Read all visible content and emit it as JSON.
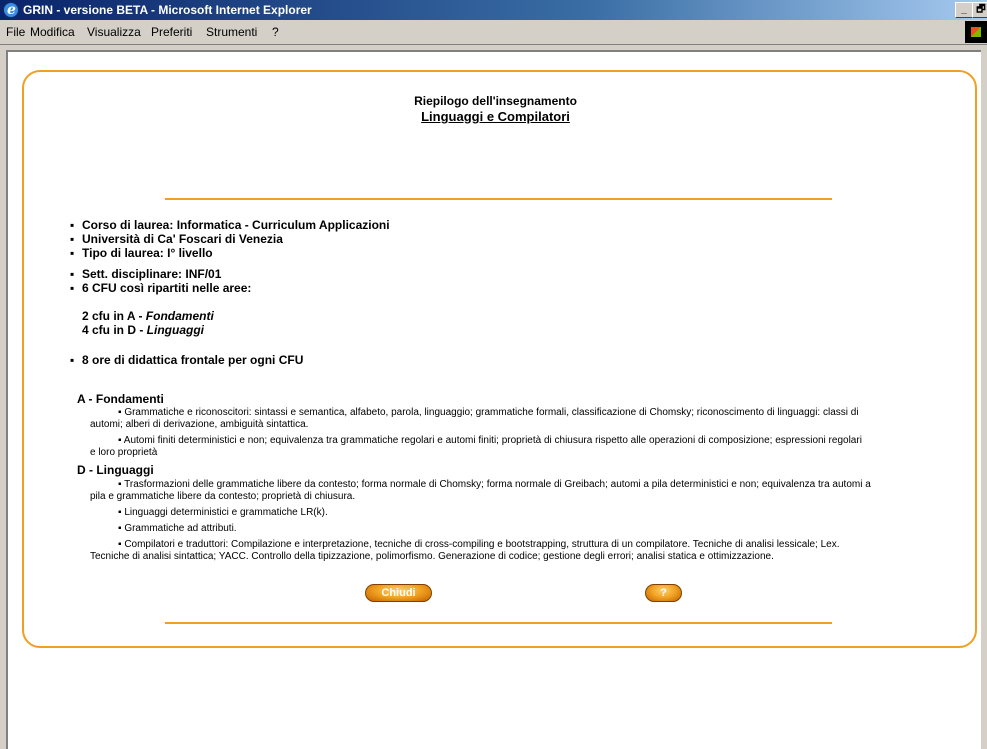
{
  "window": {
    "title": "GRIN - versione BETA - Microsoft Internet Explorer",
    "minimize": "_",
    "maximize": "🗗"
  },
  "menu": [
    "File",
    "Modifica",
    "Visualizza",
    "Preferiti",
    "Strumenti",
    "?"
  ],
  "page": {
    "heading": "Riepilogo dell'insegnamento",
    "course_title": "Linguaggi e Compilatori",
    "info": [
      "Corso di laurea: Informatica - Curriculum Applicazioni",
      "Università di Ca' Foscari di Venezia",
      "Tipo di laurea: I° livello",
      "Sett. disciplinare: INF/01",
      "6 CFU  così ripartiti nelle aree:"
    ],
    "cfu_areas": [
      {
        "prefix": "2 cfu in A - ",
        "area": "Fondamenti"
      },
      {
        "prefix": "4 cfu in D - ",
        "area": "Linguaggi"
      }
    ],
    "hours": "8 ore di didattica frontale per ogni CFU",
    "sections": [
      {
        "title": "A - Fondamenti",
        "topics": [
          {
            "line1": "Grammatiche e riconoscitori: sintassi e semantica, alfabeto, parola, linguaggio; grammatiche formali, classificazione di Chomsky; riconoscimento di linguaggi: classi di",
            "line2": "automi; alberi di derivazione, ambiguità sintattica."
          },
          {
            "line1": "Automi finiti deterministici e non; equivalenza tra grammatiche regolari e automi finiti; proprietà di chiusura rispetto alle operazioni di composizione; espressioni regolari",
            "line2": "e loro proprietà"
          }
        ]
      },
      {
        "title": "D - Linguaggi",
        "topics": [
          {
            "line1": "Trasformazioni delle grammatiche libere da contesto; forma normale di Chomsky; forma normale di Greibach; automi a pila deterministici e non; equivalenza tra automi a",
            "line2": "pila e grammatiche libere da contesto; proprietà di chiusura."
          },
          {
            "line1": "Linguaggi deterministici e grammatiche LR(k).",
            "line2": ""
          },
          {
            "line1": "Grammatiche ad attributi.",
            "line2": ""
          },
          {
            "line1": "Compilatori e traduttori: Compilazione e interpretazione, tecniche di cross-compiling e bootstrapping, struttura di un compilatore. Tecniche di analisi lessicale; Lex.",
            "line2": "Tecniche di analisi sintattica; YACC. Controllo della tipizzazione, polimorfismo. Generazione di codice; gestione degli errori; analisi statica e ottimizzazione."
          }
        ]
      }
    ],
    "buttons": {
      "close": "Chiudi",
      "help": "?"
    },
    "bullet": "▪"
  },
  "colors": {
    "accent": "#f0a020",
    "titlebar": "#0a246a"
  }
}
